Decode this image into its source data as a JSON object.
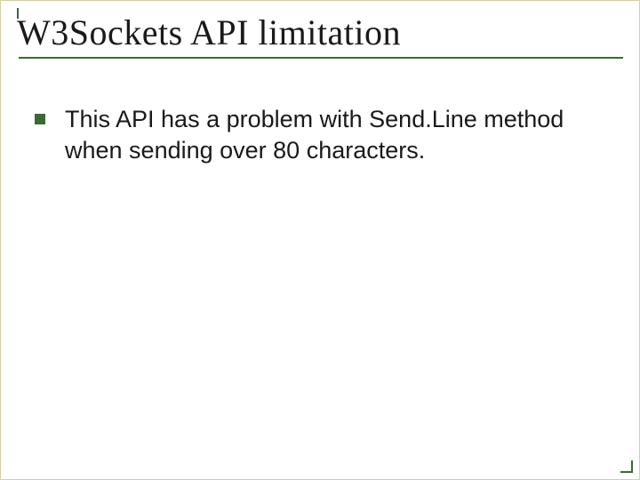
{
  "slide": {
    "title": "W3Sockets API limitation",
    "bullets": [
      {
        "text": "This API has a problem with Send.Line method when sending over 80 characters."
      }
    ]
  },
  "theme": {
    "accent": "#3a6b33",
    "border": "#d4cfa8"
  }
}
